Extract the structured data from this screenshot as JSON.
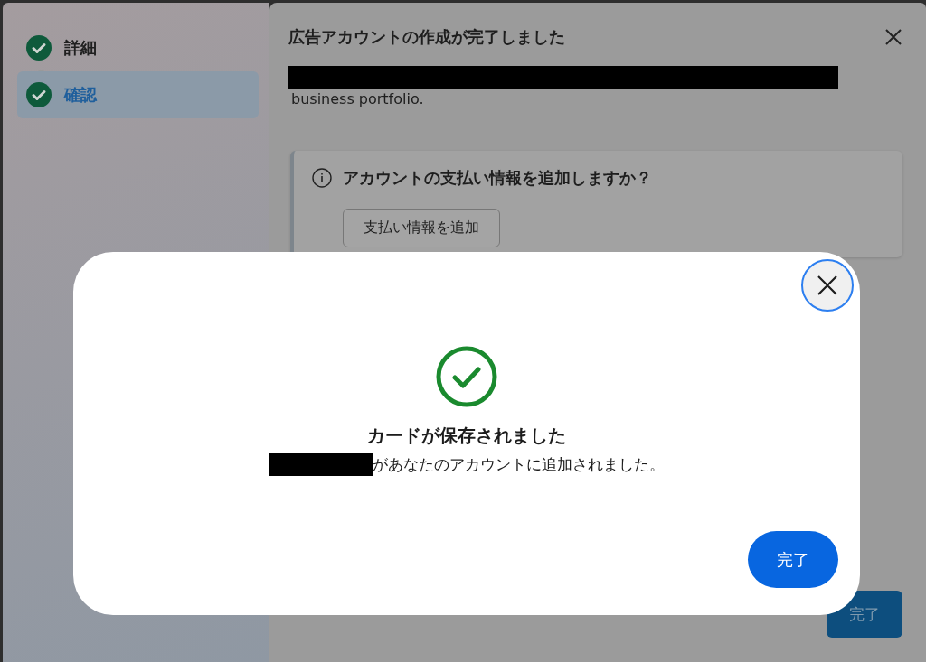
{
  "steps": [
    {
      "label": "詳細",
      "selected": false,
      "completed": true
    },
    {
      "label": "確認",
      "selected": true,
      "completed": true
    }
  ],
  "panel": {
    "title": "広告アカウントの作成が完了しました",
    "message_tail": "business portfolio.",
    "payment_card": {
      "question": "アカウントの支払い情報を追加しますか？",
      "button": "支払い情報を追加"
    },
    "done_button": "完了"
  },
  "modal": {
    "title": "カードが保存されました",
    "message": "があなたのアカウントに追加されました。",
    "done_button": "完了"
  }
}
